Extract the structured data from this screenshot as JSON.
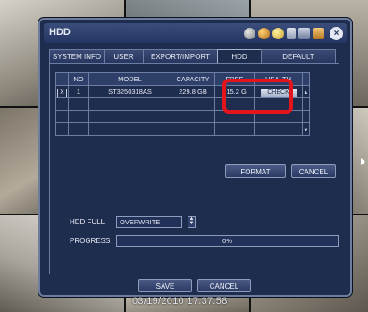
{
  "window": {
    "title": "HDD",
    "close_symbol": "×"
  },
  "tabs": [
    {
      "label": "SYSTEM INFO"
    },
    {
      "label": "USER"
    },
    {
      "label": "EXPORT/IMPORT"
    },
    {
      "label": "HDD",
      "active": true
    },
    {
      "label": "DEFAULT"
    }
  ],
  "table": {
    "headers": [
      "",
      "NO",
      "MODEL",
      "CAPACITY",
      "FREE",
      "HEALTH"
    ],
    "rows": [
      {
        "selected": "X",
        "no": "1",
        "model": "ST3250318AS",
        "capacity": "229.8 GB",
        "free": "215.2 G",
        "health_button": "CHECK"
      }
    ]
  },
  "buttons": {
    "format": "FORMAT",
    "cancel_top": "CANCEL",
    "save": "SAVE",
    "cancel_bottom": "CANCEL"
  },
  "hdd_full": {
    "label": "HDD FULL",
    "value": "OVERWRITE"
  },
  "progress": {
    "label": "PROGRESS",
    "value": 0,
    "text": "0%"
  },
  "overlay": {
    "timestamp": "03/19/2010 17:37:58"
  },
  "colors": {
    "panel_bg": "#1e2c4e",
    "highlight": "#e3141b"
  }
}
